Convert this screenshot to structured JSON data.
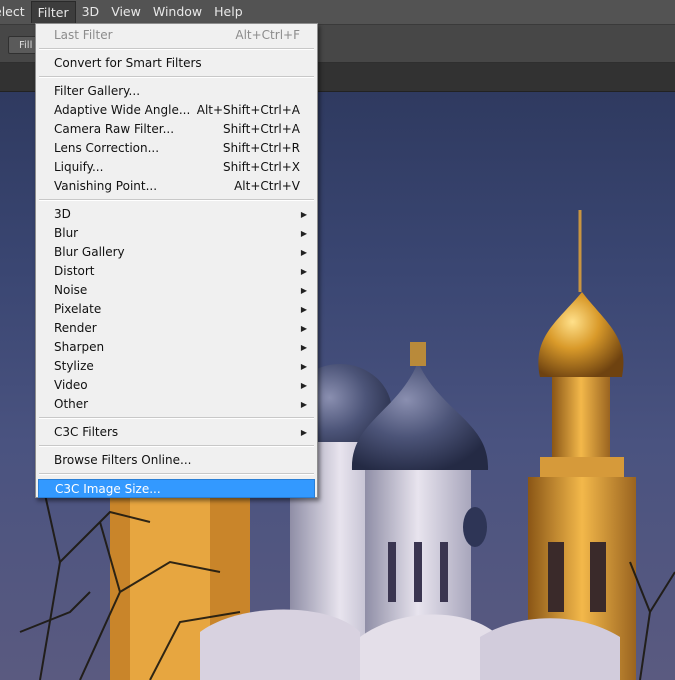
{
  "menubar": {
    "items": [
      {
        "label": "elect"
      },
      {
        "label": "Filter"
      },
      {
        "label": "3D"
      },
      {
        "label": "View"
      },
      {
        "label": "Window"
      },
      {
        "label": "Help"
      }
    ]
  },
  "options": {
    "fill_label": "Fill S"
  },
  "filter_menu": {
    "last_filter": {
      "label": "Last Filter",
      "shortcut": "Alt+Ctrl+F"
    },
    "convert": {
      "label": "Convert for Smart Filters"
    },
    "filter_gallery": {
      "label": "Filter Gallery..."
    },
    "adaptive": {
      "label": "Adaptive Wide Angle...",
      "shortcut": "Alt+Shift+Ctrl+A"
    },
    "camera_raw": {
      "label": "Camera Raw Filter...",
      "shortcut": "Shift+Ctrl+A"
    },
    "lens": {
      "label": "Lens Correction...",
      "shortcut": "Shift+Ctrl+R"
    },
    "liquify": {
      "label": "Liquify...",
      "shortcut": "Shift+Ctrl+X"
    },
    "vanishing": {
      "label": "Vanishing Point...",
      "shortcut": "Alt+Ctrl+V"
    },
    "submenus": [
      "3D",
      "Blur",
      "Blur Gallery",
      "Distort",
      "Noise",
      "Pixelate",
      "Render",
      "Sharpen",
      "Stylize",
      "Video",
      "Other"
    ],
    "c3c_filters": {
      "label": "C3C Filters"
    },
    "browse": {
      "label": "Browse Filters Online..."
    },
    "c3c_image_size": {
      "label": "C3C Image Size..."
    }
  }
}
